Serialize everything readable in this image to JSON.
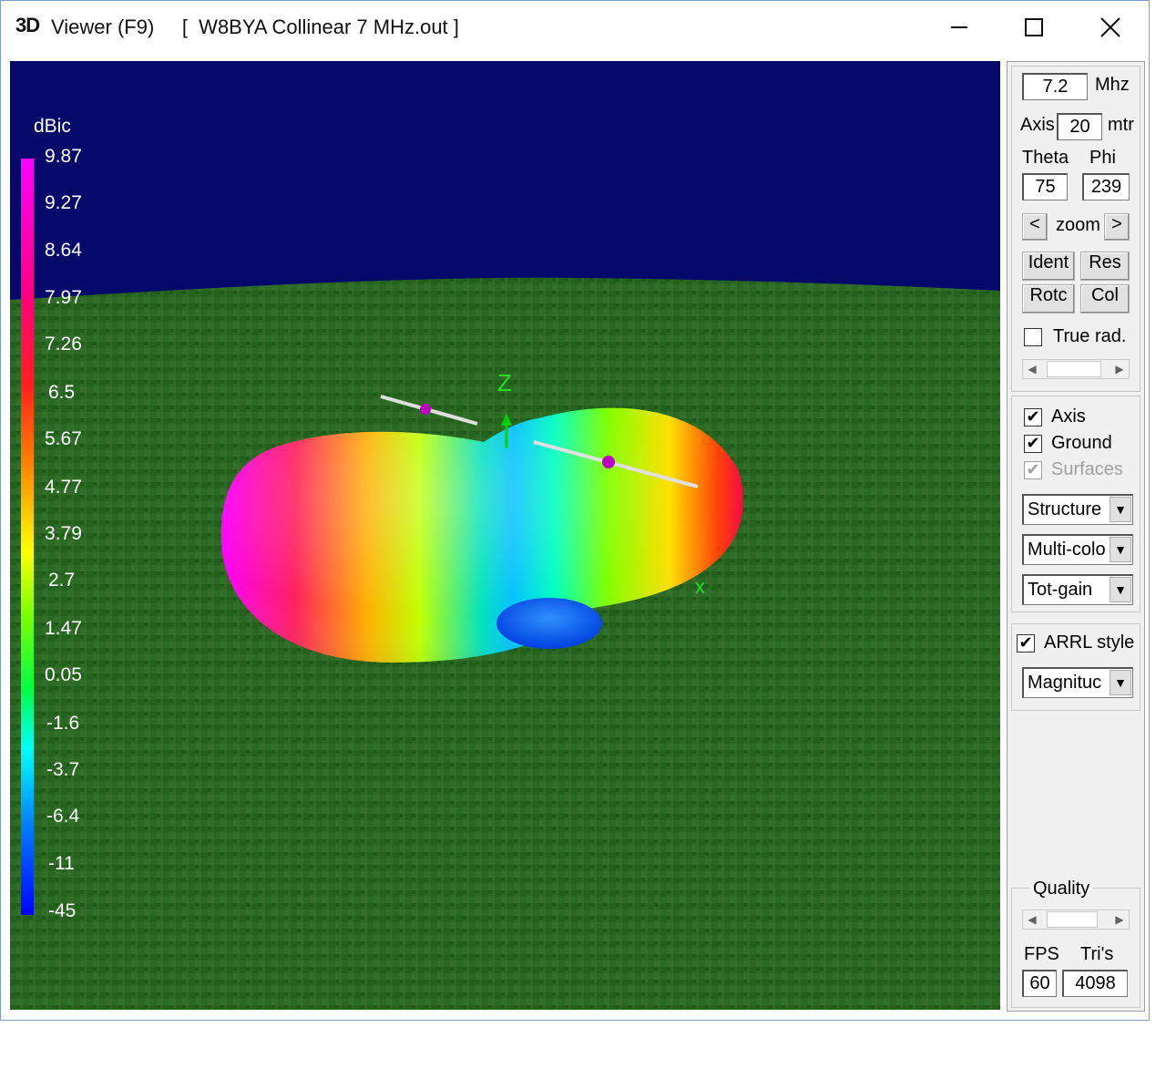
{
  "window": {
    "icon_text": "3D",
    "title": "Viewer (F9)     [  W8BYA Collinear 7 MHz.out ]",
    "controls": [
      "minimize-icon",
      "maximize-icon",
      "close-icon"
    ]
  },
  "legend": {
    "unit": "dBic",
    "values": [
      "9.87",
      "9.27",
      "8.64",
      "7.97",
      "7.26",
      "6.5",
      "5.67",
      "4.77",
      "3.79",
      "2.7",
      "1.47",
      "0.05",
      "-1.6",
      "-3.7",
      "-6.4",
      "-11",
      "-45"
    ]
  },
  "axes": {
    "z_label": "Z",
    "x_label": "x"
  },
  "panel": {
    "frequency": {
      "value": "7.2",
      "unit": "Mhz"
    },
    "axis": {
      "label": "Axis",
      "value": "20",
      "unit": "mtr"
    },
    "theta": {
      "label": "Theta",
      "value": "75"
    },
    "phi": {
      "label": "Phi",
      "value": "239"
    },
    "zoom": {
      "left": "<",
      "label": "zoom",
      "right": ">"
    },
    "buttons": {
      "ident": "Ident",
      "res": "Res",
      "rotc": "Rotc",
      "col": "Col"
    },
    "true_rad": {
      "label": "True rad.",
      "checked": false
    },
    "axis_check": {
      "label": "Axis",
      "checked": true
    },
    "ground_check": {
      "label": "Ground",
      "checked": true
    },
    "surfaces_check": {
      "label": "Surfaces",
      "checked": true,
      "disabled": true
    },
    "structure_select": "Structure",
    "color_select": "Multi-colo",
    "gain_select": "Tot-gain",
    "arrl_style": {
      "label": "ARRL style",
      "checked": true
    },
    "magnitude_select": "Magnituc",
    "quality": {
      "label": "Quality"
    },
    "fps": {
      "label": "FPS",
      "value": "60"
    },
    "tris": {
      "label": "Tri's",
      "value": "4098"
    }
  },
  "colors": {
    "sky": "#050a6a",
    "ground": "#2a6a22",
    "legend_max": "#ff00ff",
    "legend_min": "#0000ff"
  }
}
